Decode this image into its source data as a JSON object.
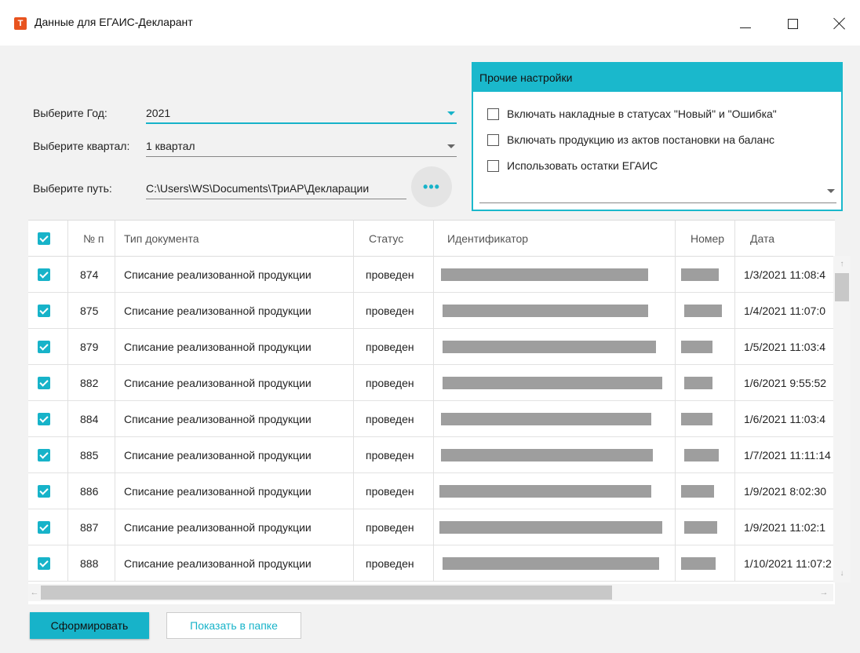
{
  "window": {
    "title": "Данные для ЕГАИС-Декларант",
    "icon_letter": "Т"
  },
  "form": {
    "year_label": "Выберите Год:",
    "year_value": "2021",
    "quarter_label": "Выберите квартал:",
    "quarter_value": "1 квартал",
    "path_label": "Выберите путь:",
    "path_value": "C:\\Users\\WS\\Documents\\ТриАР\\Декларации",
    "browse_label": "•••"
  },
  "settings": {
    "title": "Прочие настройки",
    "options": [
      {
        "label": "Включать накладные в статусах \"Новый\" и \"Ошибка\"",
        "checked": false
      },
      {
        "label": "Включать продукцию из актов постановки на баланс",
        "checked": false
      },
      {
        "label": "Использовать остатки ЕГАИС",
        "checked": false
      }
    ]
  },
  "table": {
    "columns": [
      "№ п",
      "Тип документа",
      "Статус",
      "Идентификатор",
      "Номер",
      "Дата"
    ],
    "rows": [
      {
        "n": "874",
        "type": "Списание реализованной продукции",
        "status": "проведен",
        "date": "1/3/2021 11:08:4"
      },
      {
        "n": "875",
        "type": "Списание реализованной продукции",
        "status": "проведен",
        "date": "1/4/2021 11:07:0"
      },
      {
        "n": "879",
        "type": "Списание реализованной продукции",
        "status": "проведен",
        "date": "1/5/2021 11:03:4"
      },
      {
        "n": "882",
        "type": "Списание реализованной продукции",
        "status": "проведен",
        "date": "1/6/2021 9:55:52"
      },
      {
        "n": "884",
        "type": "Списание реализованной продукции",
        "status": "проведен",
        "date": "1/6/2021 11:03:4"
      },
      {
        "n": "885",
        "type": "Списание реализованной продукции",
        "status": "проведен",
        "date": "1/7/2021 11:11:14"
      },
      {
        "n": "886",
        "type": "Списание реализованной продукции",
        "status": "проведен",
        "date": "1/9/2021 8:02:30"
      },
      {
        "n": "887",
        "type": "Списание реализованной продукции",
        "status": "проведен",
        "date": "1/9/2021 11:02:1"
      },
      {
        "n": "888",
        "type": "Списание реализованной продукции",
        "status": "проведен",
        "date": "1/10/2021 11:07:2"
      }
    ]
  },
  "actions": {
    "generate": "Сформировать",
    "show_folder": "Показать в папке"
  },
  "colors": {
    "accent": "#17b3c9"
  }
}
